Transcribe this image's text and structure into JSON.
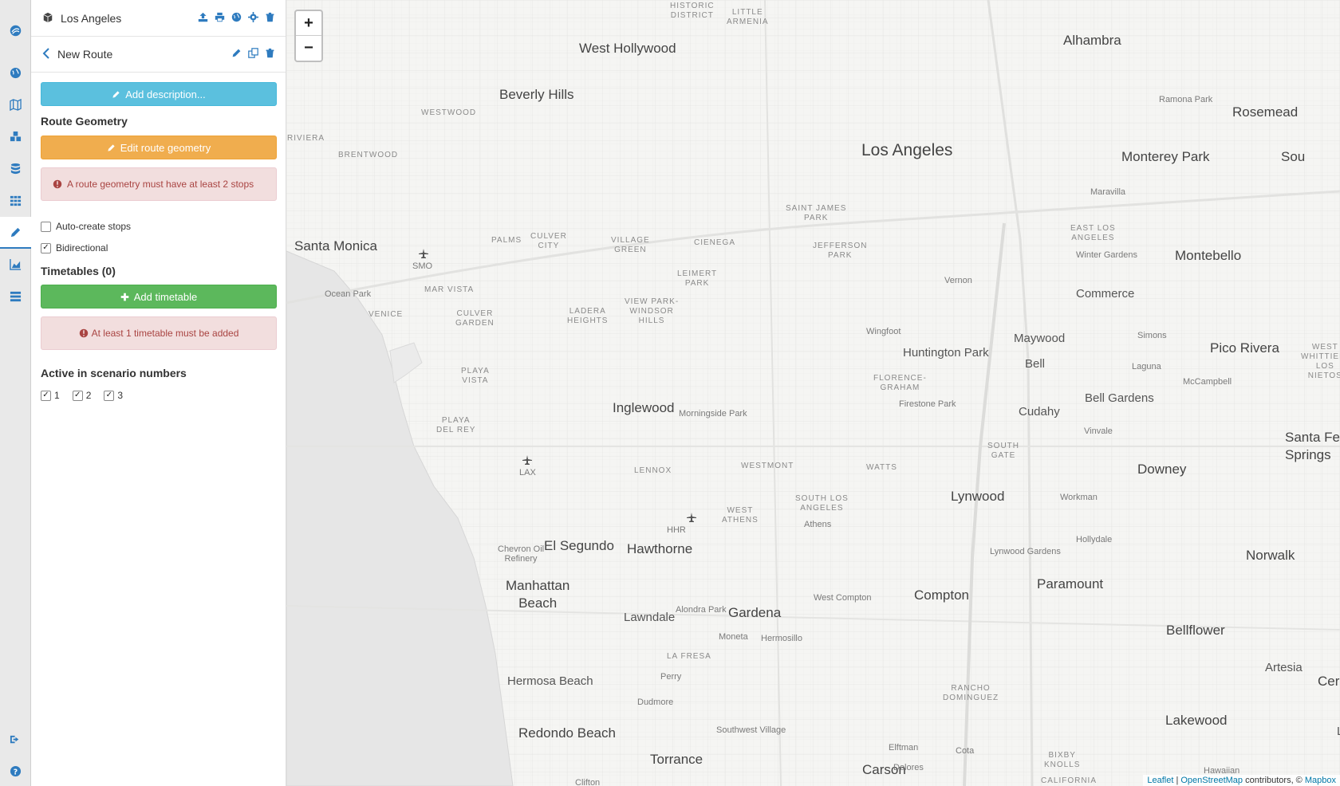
{
  "colors": {
    "primary": "#2e7bbf",
    "info": "#5bc0de",
    "warning": "#f0ad4e",
    "success": "#5cb85c",
    "danger_text": "#a94442",
    "danger_bg": "#f2dede"
  },
  "sidebar_icons": [
    "app-logo-icon",
    "globe-icon",
    "map-icon",
    "cubes-icon",
    "database-icon",
    "grid-icon",
    "pencil-icon",
    "area-chart-icon",
    "table-icon",
    "sign-out-icon",
    "help-icon"
  ],
  "project": {
    "title": "Los Angeles"
  },
  "route": {
    "title": "New Route"
  },
  "buttons": {
    "add_description": "Add description...",
    "edit_geometry": "Edit route geometry",
    "add_timetable": "Add timetable"
  },
  "sections": {
    "route_geometry": "Route Geometry",
    "timetables": "Timetables (0)",
    "active_scenarios": "Active in scenario numbers"
  },
  "alerts": {
    "geometry": "A route geometry must have at least 2 stops",
    "timetable": "At least 1 timetable must be added"
  },
  "options": {
    "auto_create_stops": "Auto-create stops",
    "auto_create_checked": false,
    "bidirectional": "Bidirectional",
    "bidirectional_checked": true
  },
  "scenarios": [
    "1",
    "2",
    "3"
  ],
  "map": {
    "zoom_in": "+",
    "zoom_out": "−",
    "labels": {
      "historic": "HISTORIC\nDISTRICT",
      "little_armenia": "LITTLE\nARMENIA",
      "west_hollywood": "West Hollywood",
      "alhambra": "Alhambra",
      "beverly_hills": "Beverly Hills",
      "westwood": "WESTWOOD",
      "ramona_park": "Ramona Park",
      "rosemead": "Rosemead",
      "riviera": "RIVIERA",
      "los_angeles": "Los Angeles",
      "brentwood": "BRENTWOOD",
      "monterey_park": "Monterey Park",
      "sou": "Sou",
      "maravilla": "Maravilla",
      "saint_james": "SAINT JAMES\nPARK",
      "east_la": "EAST LOS\nANGELES",
      "santa_monica": "Santa Monica",
      "palms": "PALMS",
      "culver_city": "CULVER\nCITY",
      "village_green": "VILLAGE\nGREEN",
      "cienega": "CIENEGA",
      "jefferson": "JEFFERSON\nPARK",
      "winter_gardens": "Winter Gardens",
      "montebello": "Montebello",
      "smo": "SMO",
      "leimert": "LEIMERT\nPARK",
      "vernon": "Vernon",
      "mar_vista": "MAR VISTA",
      "commerce": "Commerce",
      "ocean_park": "Ocean Park",
      "venice": "VENICE",
      "culver_garden": "CULVER\nGARDEN",
      "ladera": "LADERA\nHEIGHTS",
      "view_park": "VIEW PARK-\nWINDSOR\nHILLS",
      "wingfoot": "Wingfoot",
      "maywood": "Maywood",
      "simons": "Simons",
      "pico_rivera": "Pico Rivera",
      "huntington_park": "Huntington Park",
      "west_whittier": "WEST\nWHITTIER-\nLOS NIETOS",
      "playa_vista": "PLAYA\nVISTA",
      "bell": "Bell",
      "laguna": "Laguna",
      "florence": "FLORENCE-\nGRAHAM",
      "mccampbell": "McCampbell",
      "firestone": "Firestone Park",
      "bell_gardens": "Bell Gardens",
      "inglewood": "Inglewood",
      "morningside": "Morningside Park",
      "cudahy": "Cudahy",
      "playa_del_rey": "PLAYA\nDEL REY",
      "vinvale": "Vinvale",
      "santa_fe": "Santa Fe\nSprings",
      "south_gate": "SOUTH\nGATE",
      "lax": "LAX",
      "westmont": "WESTMONT",
      "watts": "WATTS",
      "lennox": "LENNOX",
      "downey": "Downey",
      "lynwood": "Lynwood",
      "south_la": "SOUTH LOS\nANGELES",
      "workman": "Workman",
      "west_athens": "WEST\nATHENS",
      "hhr": "HHR",
      "athens": "Athens",
      "hollydale": "Hollydale",
      "chevron": "Chevron Oil\nRefinery",
      "el_segundo": "El Segundo",
      "hawthorne": "Hawthorne",
      "lynwood_gardens": "Lynwood Gardens",
      "norwalk": "Norwalk",
      "manhattan": "Manhattan\nBeach",
      "paramount": "Paramount",
      "compton": "Compton",
      "west_compton": "West Compton",
      "gardena": "Gardena",
      "alondra": "Alondra Park",
      "lawndale": "Lawndale",
      "bellflower": "Bellflower",
      "moneta": "Moneta",
      "hermosillo": "Hermosillo",
      "la_fresa": "LA FRESA",
      "artesia": "Artesia",
      "perry": "Perry",
      "hermosa": "Hermosa Beach",
      "cer": "Cer",
      "rancho": "RANCHO\nDOMINGUEZ",
      "dudmore": "Dudmore",
      "lakewood": "Lakewood",
      "redondo": "Redondo Beach",
      "southwest_village": "Southwest Village",
      "torrance": "Torrance",
      "elftman": "Elftman",
      "cota": "Cota",
      "bixby": "BIXBY\nKNOLLS",
      "carson": "Carson",
      "dolores": "Dolores",
      "hawaiian": "Hawaiian",
      "california": "CALIFORNIA",
      "clifton": "Clifton",
      "lo": "L"
    },
    "attribution": {
      "leaflet": "Leaflet",
      "sep": "|",
      "osm": "OpenStreetMap",
      "contributors": "contributors, ©",
      "mapbox": "Mapbox"
    }
  }
}
